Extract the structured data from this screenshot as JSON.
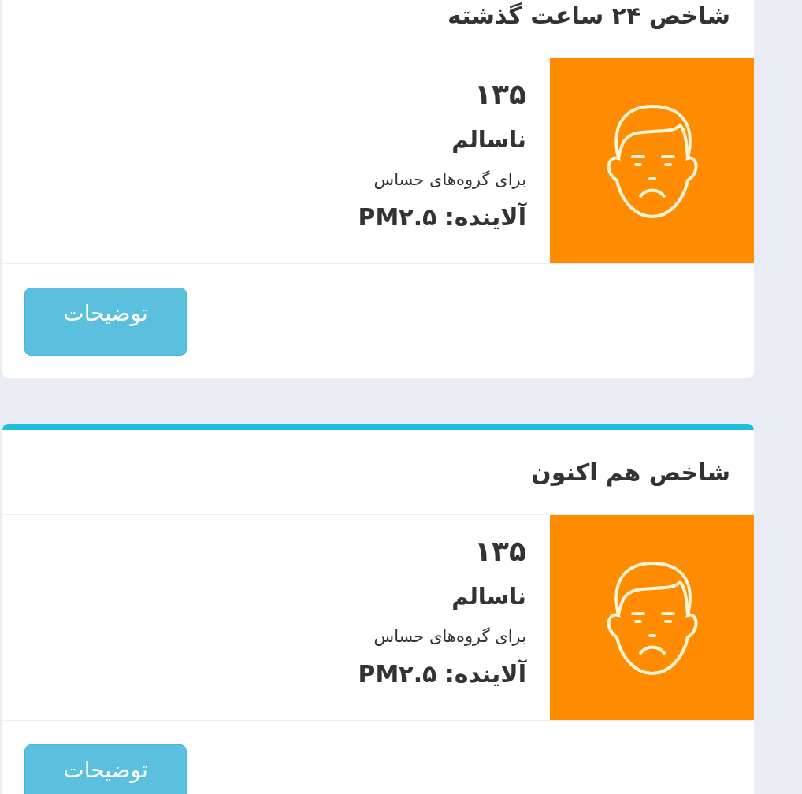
{
  "cards": [
    {
      "title": "شاخص ۲۴ ساعت گذشته",
      "index": "۱۳۵",
      "status": "ناسالم",
      "note": "برای گروه‌های حساس",
      "pollutant": "آلاینده: PM۲.۵",
      "color": "#ff8c00",
      "button": "توضیحات"
    },
    {
      "title": "شاخص هم اکنون",
      "highlighted": true,
      "index": "۱۳۵",
      "status": "ناسالم",
      "note": "برای گروه‌های حساس",
      "pollutant": "آلاینده: PM۲.۵",
      "color": "#ff8c00",
      "button": "توضیحات"
    }
  ]
}
